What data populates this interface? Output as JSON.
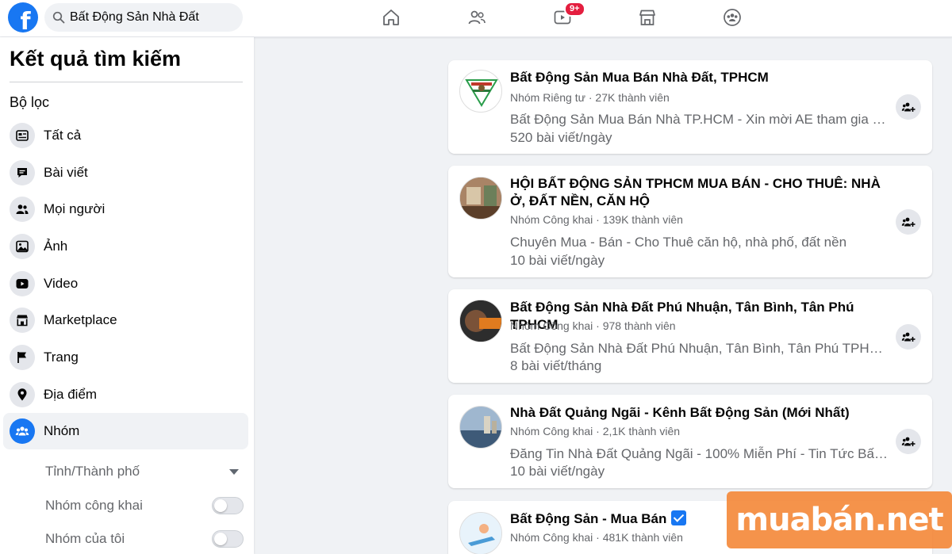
{
  "topbar": {
    "logo": "f",
    "search_value": "Bất Động Sản Nhà Đất",
    "video_badge": "9+"
  },
  "sidebar": {
    "title": "Kết quả tìm kiếm",
    "filter_label": "Bộ lọc",
    "items": [
      {
        "label": "Tất cả",
        "icon": "all-icon"
      },
      {
        "label": "Bài viết",
        "icon": "posts-icon"
      },
      {
        "label": "Mọi người",
        "icon": "people-icon"
      },
      {
        "label": "Ảnh",
        "icon": "photos-icon"
      },
      {
        "label": "Video",
        "icon": "video-icon"
      },
      {
        "label": "Marketplace",
        "icon": "marketplace-icon"
      },
      {
        "label": "Trang",
        "icon": "flag-icon"
      },
      {
        "label": "Địa điểm",
        "icon": "location-pin-icon"
      },
      {
        "label": "Nhóm",
        "icon": "groups-icon",
        "active": true
      }
    ],
    "sub_filters": [
      {
        "label": "Tỉnh/Thành phố",
        "control": "dropdown"
      },
      {
        "label": "Nhóm công khai",
        "control": "toggle",
        "on": false
      },
      {
        "label": "Nhóm của tôi",
        "control": "toggle",
        "on": false
      }
    ]
  },
  "results": [
    {
      "title": "Bất Động Sản Mua Bán Nhà Đất, TPHCM",
      "meta": "Nhóm Riêng tư · 27K thành viên",
      "description": "Bất Động Sản Mua Bán Nhà TP.HCM - Xin mời AE tham gia cùng nhóm",
      "rate": "520 bài viết/ngày"
    },
    {
      "title": "HỘI BẤT ĐỘNG SẢN TPHCM MUA BÁN - CHO THUÊ: NHÀ Ở, ĐẤT NỀN, CĂN HỘ",
      "meta": "Nhóm Công khai · 139K thành viên",
      "description": "Chuyên Mua - Bán - Cho Thuê căn hộ, nhà phố, đất nền",
      "rate": "10 bài viết/ngày"
    },
    {
      "title": "Bất Động Sản Nhà Đất Phú Nhuận, Tân Bình, Tân Phú TPHCM",
      "meta": "Nhóm Công khai · 978 thành viên",
      "description": "Bất Động Sản Nhà Đất Phú Nhuận, Tân Bình, Tân Phú TPHCM là nơi",
      "rate": "8 bài viết/tháng"
    },
    {
      "title": "Nhà Đất Quảng Ngãi - Kênh Bất Động Sản (Mới Nhất)",
      "meta": "Nhóm Công khai · 2,1K thành viên",
      "description": "Đăng Tin Nhà Đất Quảng Ngãi - 100% Miễn Phí - Tin Tức Bất Động Sản",
      "rate": "10 bài viết/ngày"
    },
    {
      "title": "Bất Động Sản - Mua Bán",
      "meta": "Nhóm Công khai · 481K thành viên",
      "description": "",
      "rate": "",
      "verified": true
    }
  ],
  "watermark": "muabán.net"
}
